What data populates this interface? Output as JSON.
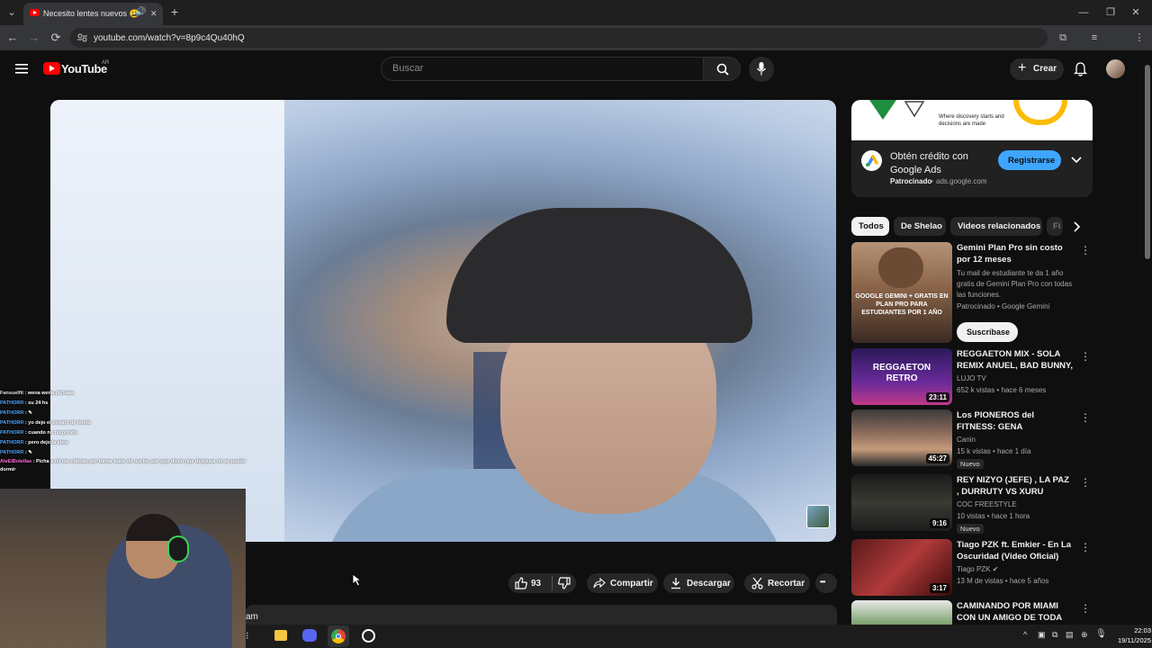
{
  "browser": {
    "tab_title": "Necesito lentes nuevos 😩",
    "url": "youtube.com/watch?v=8p9c4Qu40hQ",
    "new_tab_glyph": "+",
    "back_glyph": "←",
    "forward_glyph": "→",
    "reload_glyph": "⟳",
    "min_glyph": "—",
    "restore_glyph": "❐",
    "close_glyph": "✕",
    "tab_close_glyph": "✕"
  },
  "youtube": {
    "logo_text": "YouTube",
    "region": "AR",
    "search_placeholder": "Buscar",
    "create_label": "Crear",
    "create_glyph": "+",
    "accent": "#ff0000"
  },
  "stream_chat": [
    {
      "user": "Fansuelfit",
      "msg": " : wena wena pichaaa",
      "color": "#e0e0e0"
    },
    {
      "user": "PATHORR",
      "msg": " : su 24 hs",
      "color": "#4aa3ff"
    },
    {
      "user": "PATHORR",
      "msg": " : ✎",
      "color": "#4aa3ff"
    },
    {
      "user": "PATHORR",
      "msg": " : yo dejo el stream de fondo",
      "color": "#4aa3ff"
    },
    {
      "user": "PATHORR",
      "msg": " : cuando no respondo",
      "color": "#4aa3ff"
    },
    {
      "user": "PATHORR",
      "msg": " : pero dejo la view",
      "color": "#4aa3ff"
    },
    {
      "user": "PATHORR",
      "msg": " : ✎",
      "color": "#4aa3ff"
    },
    {
      "user": "AleElBotellas",
      "msg": " : Picha a mi me critican por tomar mate de noche, por que dicen que despues no se puede dormir",
      "color": "#ff6bd6"
    }
  ],
  "actions": {
    "like_count": "93",
    "share_label": "Compartir",
    "download_label": "Descargar",
    "clip_label": "Recortar",
    "more_glyph": "•••",
    "description_partial": "am"
  },
  "ad": {
    "banner_text": "Where discovery starts and decisions are made",
    "title": "Obtén crédito con Google Ads",
    "sponsored": "Patrocinado",
    "domain": "ads.google.com",
    "cta": "Registrarse"
  },
  "chips": [
    "Todos",
    "De Shelao",
    "Videos relacionados",
    "Fi"
  ],
  "videos": [
    {
      "title": "Gemini Plan Pro sin costo por 12 meses",
      "desc": "Tu mail de estudiante te da 1 año gratis de Gemini Plan Pro con todas las funciones.",
      "channel": "Patrocinado • Google Gemini",
      "cta": "Suscríbase",
      "thumb_text": "GOOGLE GEMINI + GRATIS EN PLAN PRO PARA ESTUDIANTES POR 1 AÑO",
      "duration": ""
    },
    {
      "title": "REGGAETON MIX - SOLA REMIX ANUEL, BAD BUNNY, ...",
      "channel": "LUJO TV",
      "stats": "652 k vistas • hace 6 meses",
      "duration": "23:11",
      "thumb_text": "REGGAETON RETRO"
    },
    {
      "title": "Los PIONEROS del FITNESS: GENA PEDRAZZOLI, NICO ...",
      "channel": "Canin",
      "stats": "15 k vistas • hace 1 día",
      "duration": "45:27",
      "badge": "Nuevo"
    },
    {
      "title": "REY NIZYO (JEFE) , LA PAZ , DURRUTY VS XURU (JEFE), ...",
      "channel": "COC FREESTYLE",
      "stats": "10 vistas • hace 1 hora",
      "duration": "9:16",
      "badge": "Nuevo"
    },
    {
      "title": "Tiago PZK ft. Emkier - En La Oscuridad (Video Oficial)",
      "channel": "Tiago PZK ✔",
      "stats": "13 M de vistas • hace 5 años",
      "duration": "3:17"
    },
    {
      "title": "CAMINANDO POR MIAMI CON UN AMIGO DE TODA LA VIDA: ...",
      "channel": "",
      "stats": "",
      "duration": ""
    }
  ],
  "taskbar": {
    "time": "22:03",
    "date": "19/11/2025"
  }
}
